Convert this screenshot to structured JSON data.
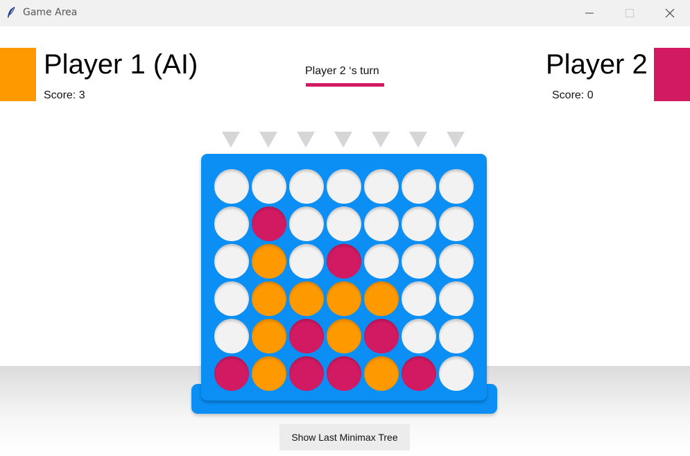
{
  "window": {
    "title": "Game Area",
    "icon": "feather-icon",
    "controls": [
      "minimize-icon",
      "maximize-icon",
      "close-icon"
    ]
  },
  "players": [
    {
      "name": "Player 1 (AI)",
      "score_text": "Score: 3",
      "color": "#ff9900"
    },
    {
      "name": "Player 2",
      "score_text": "Score: 0",
      "color": "#d11a62"
    }
  ],
  "turn": {
    "text": "Player 2 ‘s turn",
    "color": "#d11a62"
  },
  "board": {
    "color": "#0b8ff5",
    "columns": 7,
    "rows": 6,
    "column_arrow_icon": "drop-arrow-icon",
    "cells": [
      [
        "",
        "",
        "",
        "",
        "",
        "",
        ""
      ],
      [
        "",
        "p2",
        "",
        "",
        "",
        "",
        ""
      ],
      [
        "",
        "p1",
        "",
        "p2",
        "",
        "",
        ""
      ],
      [
        "",
        "p1",
        "p1",
        "p1",
        "p1",
        "",
        ""
      ],
      [
        "",
        "p1",
        "p2",
        "p1",
        "p2",
        "",
        ""
      ],
      [
        "p2",
        "p1",
        "p2",
        "p2",
        "p1",
        "p2",
        ""
      ]
    ]
  },
  "buttons": {
    "show_tree": "Show Last Minimax Tree"
  }
}
